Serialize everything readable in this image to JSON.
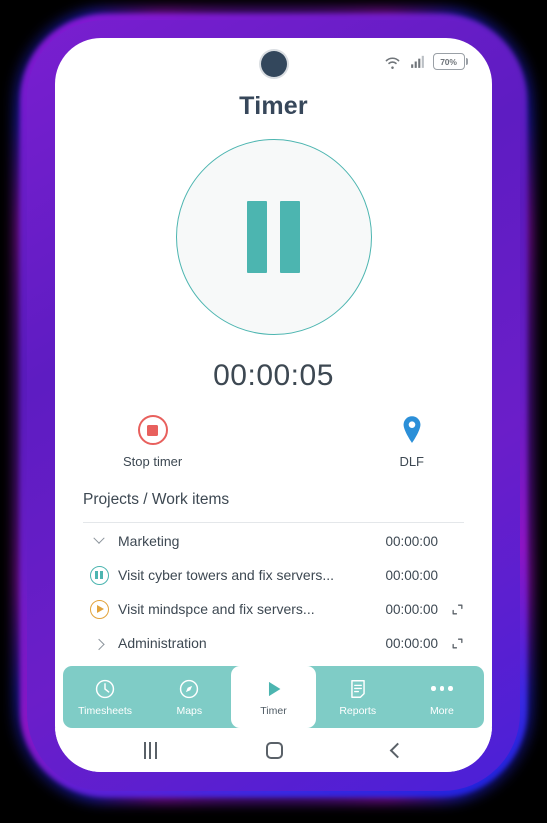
{
  "theme": {
    "teal": "#4cb5b0",
    "nav_teal": "#7fccc6",
    "red": "#e8605d",
    "blue_pin": "#2b8fd8",
    "amber": "#e2a33c",
    "text_dark": "#3d4852",
    "frame_purple": "#6a1ec9"
  },
  "status_bar": {
    "wifi_icon": "wifi-icon",
    "signal_icon": "signal-bars-icon",
    "battery_icon": "battery-icon",
    "battery_level": "70%"
  },
  "header": {
    "title": "Timer"
  },
  "timer": {
    "state_icon": "pause-icon",
    "elapsed": "00:00:05"
  },
  "actions": [
    {
      "icon": "stop-icon",
      "label": "Stop timer"
    },
    {
      "icon": "location-pin-icon",
      "label": "DLF"
    }
  ],
  "projects": {
    "heading": "Projects / Work items",
    "rows": [
      {
        "lead_icon": "chevron-down-icon",
        "label": "Marketing",
        "time": "00:00:00",
        "expand": false
      },
      {
        "lead_icon": "pause-circle-icon",
        "label": "Visit cyber towers and fix servers...",
        "time": "00:00:00",
        "expand": false
      },
      {
        "lead_icon": "play-circle-icon",
        "label": "Visit mindspce and fix servers...",
        "time": "00:00:00",
        "expand": true
      },
      {
        "lead_icon": "chevron-right-icon",
        "label": "Administration",
        "time": "00:00:00",
        "expand": true
      }
    ]
  },
  "bottom_nav": {
    "items": [
      {
        "icon": "clock-icon",
        "label": "Timesheets",
        "active": false
      },
      {
        "icon": "compass-icon",
        "label": "Maps",
        "active": false
      },
      {
        "icon": "play-icon",
        "label": "Timer",
        "active": true
      },
      {
        "icon": "document-icon",
        "label": "Reports",
        "active": false
      },
      {
        "icon": "ellipsis-icon",
        "label": "More",
        "active": false
      }
    ]
  },
  "android_nav": {
    "recents_icon": "recents-icon",
    "home_icon": "home-icon",
    "back_icon": "back-icon"
  }
}
